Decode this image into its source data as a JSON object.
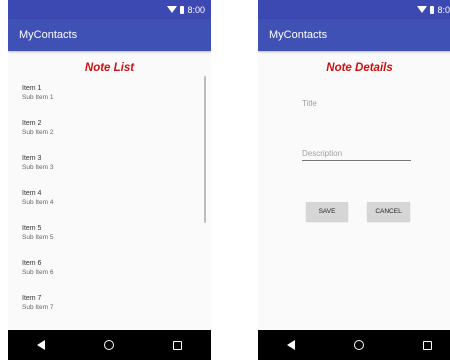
{
  "status_bar": {
    "time": "8:00"
  },
  "list_screen": {
    "app_title": "MyContacts",
    "heading": "Note List",
    "items": [
      {
        "title": "Item 1",
        "subtitle": "Sub Item 1"
      },
      {
        "title": "Item 2",
        "subtitle": "Sub Item 2"
      },
      {
        "title": "Item 3",
        "subtitle": "Sub Item 3"
      },
      {
        "title": "Item 4",
        "subtitle": "Sub Item 4"
      },
      {
        "title": "Item 5",
        "subtitle": "Sub Item 5"
      },
      {
        "title": "Item 6",
        "subtitle": "Sub Item 6"
      },
      {
        "title": "Item 7",
        "subtitle": "Sub Item 7"
      }
    ]
  },
  "detail_screen": {
    "app_title": "MyContacts",
    "heading": "Note Details",
    "title_placeholder": "Title",
    "description_placeholder": "Description",
    "save_label": "SAVE",
    "cancel_label": "CANCEL"
  },
  "colors": {
    "app_bar": "#3f51b5",
    "status_bar": "#3d49b3",
    "heading": "#cc1111",
    "nav_bar": "#000000"
  },
  "icons": [
    "wifi-icon",
    "battery-icon",
    "back-icon",
    "home-icon",
    "recents-icon"
  ]
}
